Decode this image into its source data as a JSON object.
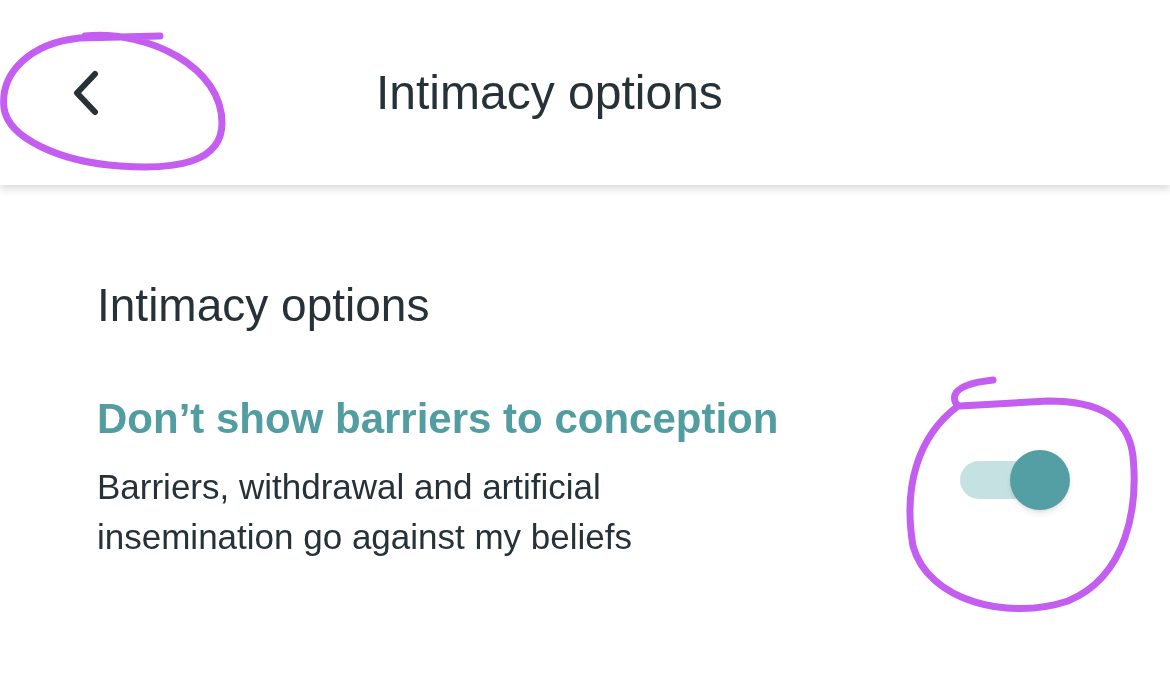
{
  "header": {
    "title": "Intimacy options"
  },
  "section": {
    "heading": "Intimacy options"
  },
  "settings": [
    {
      "title": "Don’t show barriers to conception",
      "description": "Barriers, withdrawal and artificial insemination go against my beliefs",
      "on": true
    }
  ]
}
